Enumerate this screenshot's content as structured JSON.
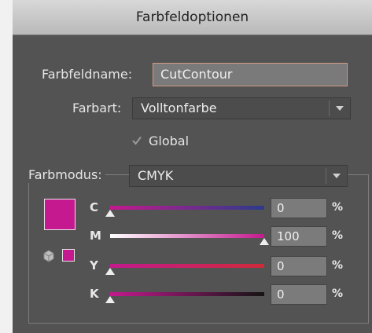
{
  "dialog": {
    "title": "Farbfeldoptionen"
  },
  "swatch_name": {
    "label": "Farbfeldname:",
    "value": "CutContour"
  },
  "color_type": {
    "label": "Farbart:",
    "value": "Volltonfarbe"
  },
  "global": {
    "label": "Global",
    "checked": true
  },
  "color_mode": {
    "label": "Farbmodus:",
    "value": "CMYK"
  },
  "swatch_color": "#c4198f",
  "channels": [
    {
      "label": "C",
      "value": "0",
      "fraction": 0.0,
      "gradient": [
        "#c4198f",
        "#2d3a8c"
      ]
    },
    {
      "label": "M",
      "value": "100",
      "fraction": 1.0,
      "gradient": [
        "#ffffff",
        "#c4198f"
      ]
    },
    {
      "label": "Y",
      "value": "0",
      "fraction": 0.0,
      "gradient": [
        "#c4198f",
        "#d02a3a"
      ]
    },
    {
      "label": "K",
      "value": "0",
      "fraction": 0.0,
      "gradient": [
        "#c4198f",
        "#141414"
      ]
    }
  ],
  "percent_sign": "%"
}
